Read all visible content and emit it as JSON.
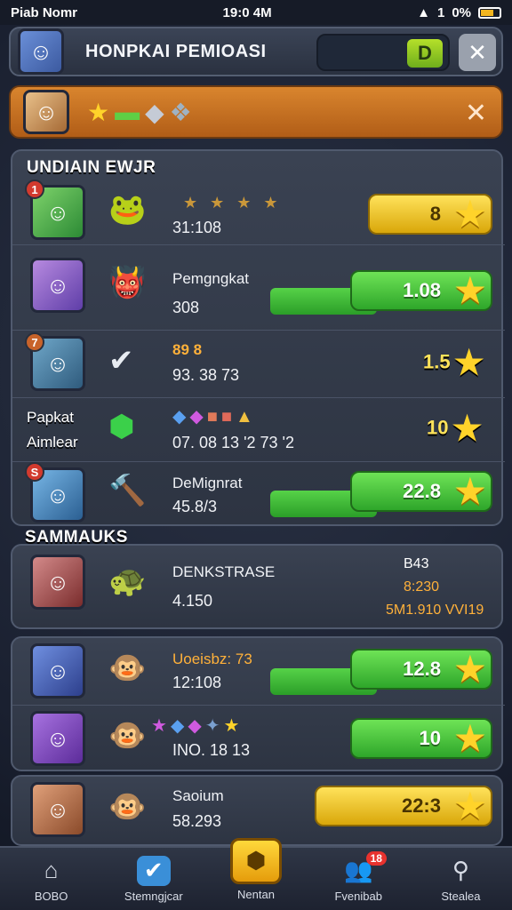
{
  "status_bar": {
    "carrier": "Piab Nomr",
    "time": "19:0 4M",
    "signal": "1",
    "battery": "0%"
  },
  "header": {
    "title": "HONPKAI PEMIOASI",
    "progress_label": "D",
    "close_icon": "close-icon"
  },
  "banner": {
    "close_icon": "close-icon",
    "icons": [
      "star-icon",
      "arrow-icon",
      "shield-icon",
      "dragon-icon"
    ]
  },
  "section1": {
    "label": "UNDIAIN EWJR",
    "rows": [
      {
        "rank": "1",
        "name": "",
        "value": "31:108",
        "score": "8",
        "score_style": "yellow"
      },
      {
        "rank": "",
        "name": "Pemgngkat",
        "value": "308",
        "score": "1.08",
        "score_style": "green"
      },
      {
        "rank": "7",
        "name": "89  8",
        "value": "93. 38  73",
        "score": "1.5",
        "score_style": "plain"
      },
      {
        "rank": "",
        "name": "",
        "value": "07. 08   13  '2  73  '2",
        "score": "10",
        "score_style": "plain"
      },
      {
        "rank": "S",
        "name": "DeMignrat",
        "value": "45.8/3",
        "score": "22.8",
        "score_style": "green"
      }
    ],
    "side_labels": [
      "Papkat",
      "Aimlear"
    ]
  },
  "section2": {
    "label": "SAMMAUKS",
    "row": {
      "name": "DENKSTRASE",
      "value": "4.150",
      "right_top": "B43",
      "right_mid": "8:230",
      "right_bottom": "5M1.910 VVI19"
    }
  },
  "section3": {
    "rows": [
      {
        "name": "Uoeisbz: 73",
        "value": "12:108",
        "score": "12.8",
        "score_style": "green"
      },
      {
        "name": "",
        "value": "INO. 18    13",
        "score": "10",
        "score_style": "green"
      }
    ]
  },
  "section4": {
    "row": {
      "name": "Saoium",
      "value": "58.293",
      "score": "22:3",
      "score_style": "yellow"
    }
  },
  "nav": [
    {
      "label": "BOBO",
      "icon": "home-icon"
    },
    {
      "label": "Stemngjcar",
      "icon": "check-icon"
    },
    {
      "label": "Nentan",
      "icon": "shield-icon"
    },
    {
      "label": "Fvenibab",
      "icon": "people-icon",
      "badge": "18"
    },
    {
      "label": "Stealea",
      "icon": "search-icon"
    }
  ],
  "colors": {
    "accent_green": "#2ea62a",
    "accent_yellow": "#ffd32a",
    "banner_orange": "#d9852e"
  }
}
